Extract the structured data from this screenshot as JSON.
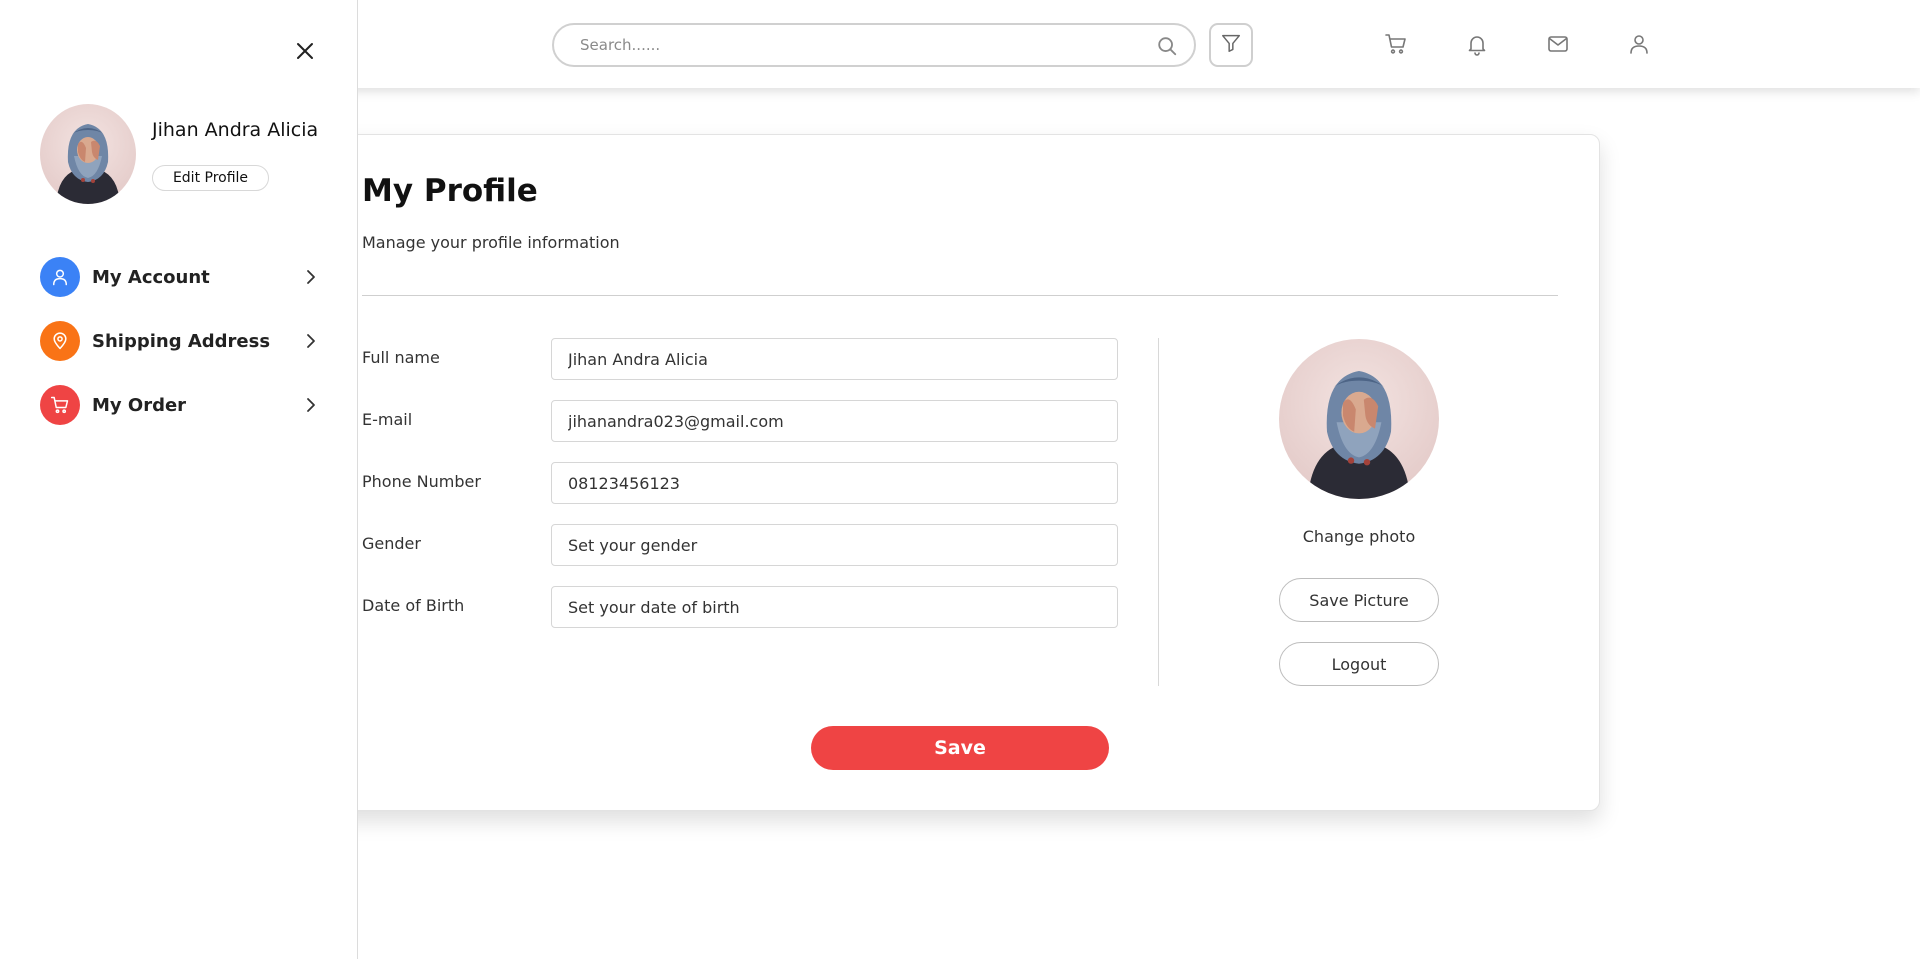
{
  "header": {
    "search_placeholder": "Search......",
    "icons": [
      "search-icon",
      "filter-icon",
      "cart-icon",
      "bell-icon",
      "mail-icon",
      "user-icon"
    ]
  },
  "sidebar": {
    "user_name": "Jihan Andra Alicia",
    "edit_profile_label": "Edit Profile",
    "items": [
      {
        "label": "My Account",
        "icon": "user-icon",
        "color": "#3b82f6"
      },
      {
        "label": "Shipping Address",
        "icon": "location-pin-icon",
        "color": "#f97316"
      },
      {
        "label": "My Order",
        "icon": "cart-icon",
        "color": "#ef4444"
      }
    ]
  },
  "profile": {
    "title": "My Profile",
    "subtitle": "Manage your profile information",
    "fields": [
      {
        "label": "Full name",
        "value": "Jihan Andra Alicia",
        "placeholder": ""
      },
      {
        "label": "E-mail",
        "value": "jihanandra023@gmail.com",
        "placeholder": ""
      },
      {
        "label": "Phone Number",
        "value": "08123456123",
        "placeholder": ""
      },
      {
        "label": "Gender",
        "value": "",
        "placeholder": "Set your gender"
      },
      {
        "label": "Date of Birth",
        "value": "",
        "placeholder": "Set your date of birth"
      }
    ],
    "change_photo_label": "Change photo",
    "save_picture_label": "Save Picture",
    "logout_label": "Logout",
    "save_label": "Save"
  },
  "colors": {
    "accent_red": "#ef4444",
    "blue": "#3b82f6",
    "orange": "#f97316"
  }
}
